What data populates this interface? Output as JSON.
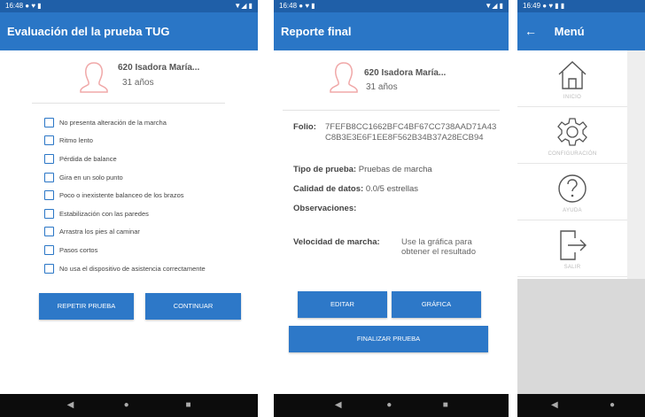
{
  "screen1": {
    "status_time": "16:48",
    "title": "Evaluación del la prueba TUG",
    "profile": {
      "name": "620 Isadora María...",
      "age": "31 años"
    },
    "checklist": [
      {
        "label": "No presenta alteración de la marcha",
        "checked": false
      },
      {
        "label": "Ritmo lento",
        "checked": false
      },
      {
        "label": "Pérdida de balance",
        "checked": false
      },
      {
        "label": "Gira en un solo punto",
        "checked": false
      },
      {
        "label": "Poco o inexistente balanceo de los brazos",
        "checked": false
      },
      {
        "label": "Estabilización con las paredes",
        "checked": false
      },
      {
        "label": "Arrastra los pies al caminar",
        "checked": false
      },
      {
        "label": "Pasos cortos",
        "checked": false
      },
      {
        "label": "No usa el dispositivo de asistencia correctamente",
        "checked": false
      }
    ],
    "repeat_button": "REPETIR PRUEBA",
    "continue_button": "CONTINUAR"
  },
  "screen2": {
    "status_time": "16:48",
    "title": "Reporte final",
    "profile": {
      "name": "620 Isadora María...",
      "age": "31 años"
    },
    "folio_label": "Folio:",
    "folio_value": "7FEFB8CC1662BFC4BF67CC738AAD71A43C8B3E3E6F1EE8F562B34B37A28ECB94",
    "test_type_label": "Tipo de prueba:",
    "test_type_value": "Pruebas de marcha",
    "data_quality_label": "Calidad de datos:",
    "data_quality_value": "0.0/5 estrellas",
    "observations_label": "Observaciones:",
    "speed_label": "Velocidad de marcha:",
    "speed_value": "Use la gráfica para obtener el resultado",
    "edit_button": "EDITAR",
    "chart_button": "GRÁFICA",
    "finish_button": "FINALIZAR PRUEBA"
  },
  "screen3": {
    "status_time": "16:49",
    "title": "Menú",
    "items": [
      {
        "label": "INICIO",
        "icon": "home-icon"
      },
      {
        "label": "CONFIGURACIÓN",
        "icon": "gear-icon"
      },
      {
        "label": "AYUDA",
        "icon": "help-icon"
      },
      {
        "label": "SALIR",
        "icon": "exit-icon"
      }
    ]
  },
  "colors": {
    "primary": "#2a76c6",
    "status": "#1f5fa8",
    "avatar": "#f2b8b8",
    "navbar": "#0c0c0c"
  }
}
